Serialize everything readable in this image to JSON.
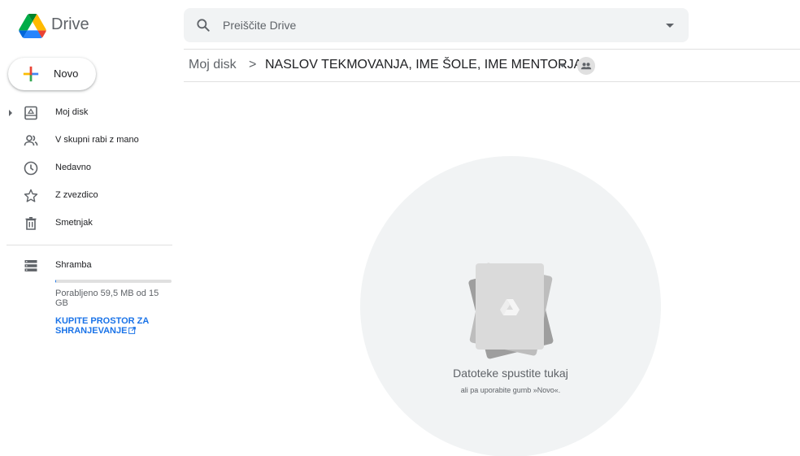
{
  "app": {
    "title": "Drive"
  },
  "search": {
    "placeholder": "Preiščite Drive"
  },
  "new_button": {
    "label": "Novo"
  },
  "sidebar": {
    "items": [
      {
        "label": "Moj disk",
        "icon": "my-drive-icon"
      },
      {
        "label": "V skupni rabi z mano",
        "icon": "shared-with-me-icon"
      },
      {
        "label": "Nedavno",
        "icon": "clock-icon"
      },
      {
        "label": "Z zvezdico",
        "icon": "star-icon"
      },
      {
        "label": "Smetnjak",
        "icon": "trash-icon"
      }
    ],
    "storage": {
      "label": "Shramba",
      "used_text": "Porabljeno 59,5 MB od 15 GB",
      "buy_link": "KUPITE PROSTOR ZA SHRANJEVANJE",
      "used_fraction": 0.004
    }
  },
  "breadcrumb": {
    "root": "Moj disk",
    "separator": ">",
    "current": "NASLOV TEKMOVANJA, IME ŠOLE, IME MENTORJA"
  },
  "empty_state": {
    "title": "Datoteke spustite tukaj",
    "subtitle": "ali pa uporabite gumb »Novo«."
  },
  "colors": {
    "accent": "#1a73e8",
    "surface": "#f1f3f4",
    "text_secondary": "#5f6368"
  }
}
